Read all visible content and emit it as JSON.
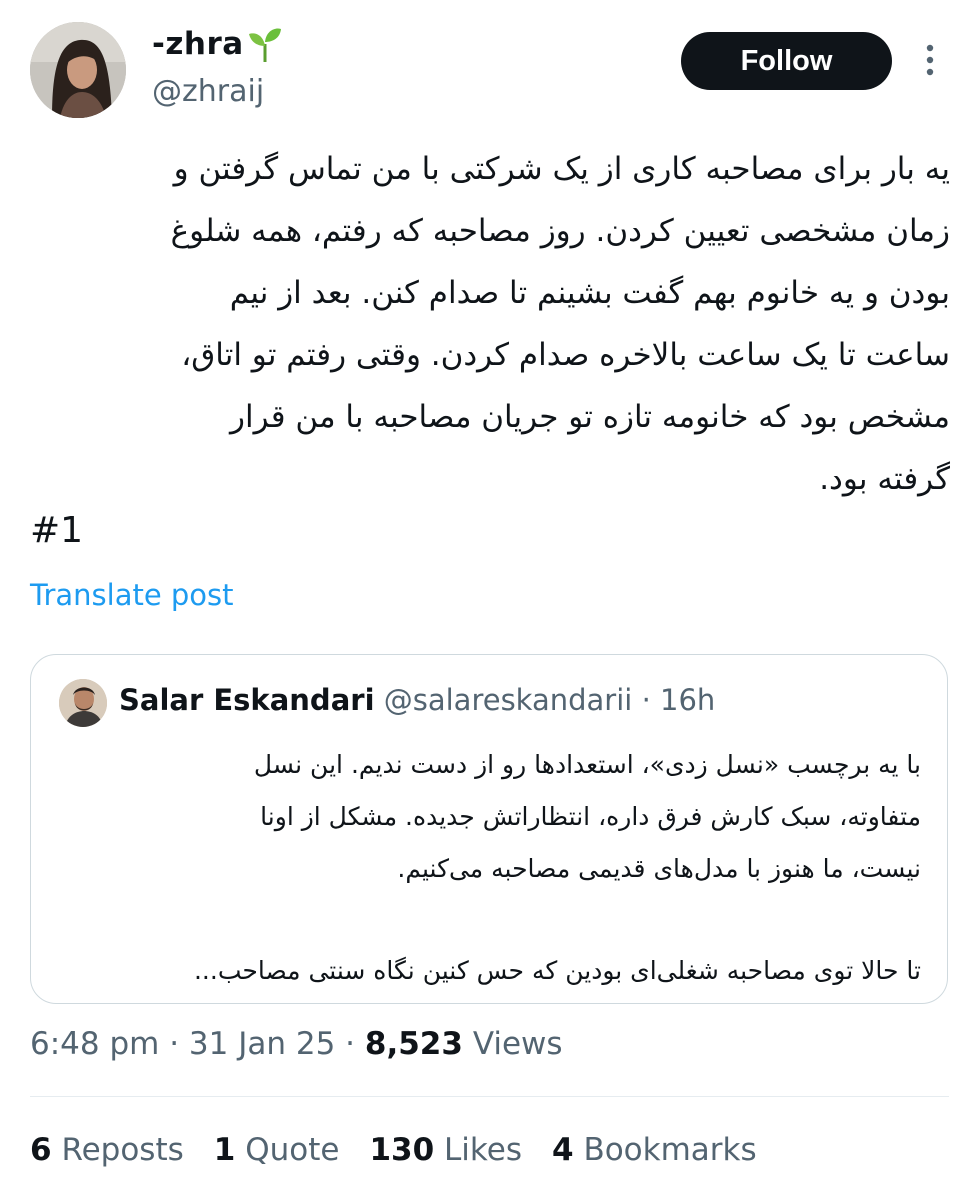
{
  "author": {
    "name": "-zhra",
    "handle": "@zhraij"
  },
  "follow_label": "Follow",
  "tweet": {
    "lines": [
      "یه بار برای مصاحبه کاری از یک شرکتی با من تماس گرفتن و",
      "زمان مشخصی تعیین کردن. روز مصاحبه که رفتم، همه شلوغ",
      "بودن و یه خانوم بهم گفت بشینم تا صدام کنن. بعد از نیم",
      "ساعت تا یک ساعت بالاخره صدام کردن. وقتی رفتم تو اتاق،",
      "مشخص بود که خانومه تازه تو جریان مصاحبه با من قرار",
      "گرفته بود."
    ],
    "tag": "#1",
    "translate_label": "Translate post"
  },
  "quote": {
    "name": "Salar Eskandari",
    "handle": "@salareskandarii",
    "separator": "·",
    "time": "16h",
    "para1": [
      "با یه برچسب «نسل زدی»، استعدادها رو از دست ندیم. این نسل",
      "متفاوته، سبک کارش فرق داره، انتظاراتش جدیده. مشکل از اونا",
      "نیست، ما هنوز با مدل‌های قدیمی مصاحبه می‌کنیم."
    ],
    "para2": "تا حالا توی مصاحبه شغلی‌ای بودین که حس کنین نگاه سنتی مصاحب..."
  },
  "meta": {
    "time": "6:48 pm",
    "date": "31 Jan 25",
    "dot": "·",
    "views_count": "8,523",
    "views_label": "Views"
  },
  "stats": {
    "reposts_count": "6",
    "reposts_label": "Reposts",
    "quotes_count": "1",
    "quotes_label": "Quote",
    "likes_count": "130",
    "likes_label": "Likes",
    "bookmarks_count": "4",
    "bookmarks_label": "Bookmarks"
  },
  "colors": {
    "accent": "#1d9bf0",
    "text": "#0f1419",
    "secondary": "#536471",
    "sprout": "#6abf3a"
  },
  "icons": {
    "name_emoji": "seedling-icon",
    "more": "more-vertical-icon"
  }
}
